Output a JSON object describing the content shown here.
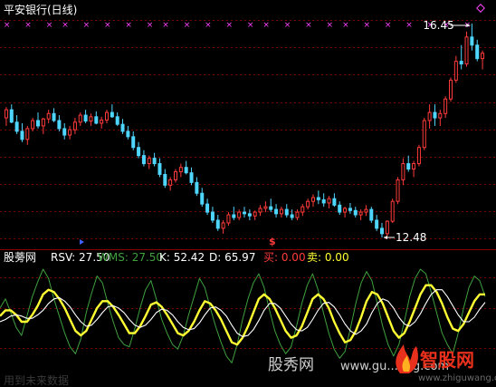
{
  "chart_data": [
    {
      "type": "candlestick",
      "title": "平安银行(日线)",
      "annotations": {
        "high_label": "16.45",
        "low_label": "12.48",
        "signal_glyph": "$"
      },
      "x_markers": {
        "glyph": "×",
        "count": 24
      },
      "colors": {
        "up": "#ff3b3b",
        "down": "#4fd6ff",
        "grid": "#7a0000",
        "title": "#ffffff",
        "marker": "#ff44ff",
        "signal": "#ff3b3b"
      },
      "series": [
        {
          "name": "candles",
          "values": [
            [
              14.7,
              14.9,
              14.55,
              14.85
            ],
            [
              14.85,
              14.95,
              14.6,
              14.62
            ],
            [
              14.62,
              14.75,
              14.4,
              14.45
            ],
            [
              14.45,
              14.6,
              14.25,
              14.3
            ],
            [
              14.3,
              14.55,
              14.2,
              14.5
            ],
            [
              14.5,
              14.7,
              14.45,
              14.65
            ],
            [
              14.65,
              14.8,
              14.5,
              14.55
            ],
            [
              14.55,
              14.7,
              14.4,
              14.68
            ],
            [
              14.68,
              14.85,
              14.6,
              14.78
            ],
            [
              14.78,
              14.88,
              14.62,
              14.65
            ],
            [
              14.65,
              14.75,
              14.45,
              14.5
            ],
            [
              14.5,
              14.6,
              14.3,
              14.38
            ],
            [
              14.38,
              14.55,
              14.3,
              14.48
            ],
            [
              14.48,
              14.7,
              14.4,
              14.62
            ],
            [
              14.62,
              14.8,
              14.55,
              14.75
            ],
            [
              14.75,
              14.85,
              14.6,
              14.64
            ],
            [
              14.64,
              14.78,
              14.55,
              14.72
            ],
            [
              14.72,
              14.82,
              14.58,
              14.6
            ],
            [
              14.6,
              14.72,
              14.5,
              14.66
            ],
            [
              14.66,
              14.85,
              14.6,
              14.8
            ],
            [
              14.8,
              14.95,
              14.7,
              14.72
            ],
            [
              14.72,
              14.8,
              14.55,
              14.58
            ],
            [
              14.58,
              14.68,
              14.4,
              14.45
            ],
            [
              14.45,
              14.55,
              14.3,
              14.35
            ],
            [
              14.35,
              14.45,
              14.1,
              14.15
            ],
            [
              14.15,
              14.25,
              13.95,
              14.0
            ],
            [
              14.0,
              14.1,
              13.8,
              13.85
            ],
            [
              13.85,
              14.0,
              13.75,
              13.95
            ],
            [
              13.95,
              14.05,
              13.8,
              13.85
            ],
            [
              13.85,
              13.95,
              13.6,
              13.65
            ],
            [
              13.65,
              13.75,
              13.4,
              13.45
            ],
            [
              13.45,
              13.6,
              13.35,
              13.55
            ],
            [
              13.55,
              13.75,
              13.5,
              13.7
            ],
            [
              13.7,
              13.85,
              13.6,
              13.78
            ],
            [
              13.78,
              13.9,
              13.65,
              13.68
            ],
            [
              13.68,
              13.78,
              13.45,
              13.5
            ],
            [
              13.5,
              13.6,
              13.25,
              13.3
            ],
            [
              13.3,
              13.4,
              13.05,
              13.1
            ],
            [
              13.1,
              13.2,
              12.9,
              12.95
            ],
            [
              12.95,
              13.05,
              12.75,
              12.8
            ],
            [
              12.8,
              12.9,
              12.6,
              12.65
            ],
            [
              12.65,
              12.8,
              12.55,
              12.75
            ],
            [
              12.75,
              12.95,
              12.7,
              12.9
            ],
            [
              12.9,
              13.05,
              12.8,
              12.85
            ],
            [
              12.85,
              13.0,
              12.8,
              12.95
            ],
            [
              12.95,
              13.05,
              12.85,
              12.92
            ],
            [
              12.92,
              13.0,
              12.8,
              12.88
            ],
            [
              12.88,
              12.98,
              12.8,
              12.95
            ],
            [
              12.95,
              13.08,
              12.88,
              13.02
            ],
            [
              13.02,
              13.15,
              12.95,
              13.05
            ],
            [
              13.05,
              13.2,
              12.95,
              13.0
            ],
            [
              13.0,
              13.1,
              12.85,
              12.92
            ],
            [
              12.92,
              13.05,
              12.85,
              13.0
            ],
            [
              13.0,
              13.1,
              12.85,
              12.9
            ],
            [
              12.9,
              13.0,
              12.8,
              12.85
            ],
            [
              12.85,
              13.0,
              12.8,
              12.95
            ],
            [
              12.95,
              13.1,
              12.88,
              13.05
            ],
            [
              13.05,
              13.2,
              13.0,
              13.15
            ],
            [
              13.15,
              13.28,
              13.05,
              13.22
            ],
            [
              13.22,
              13.35,
              13.1,
              13.18
            ],
            [
              13.18,
              13.3,
              13.05,
              13.12
            ],
            [
              13.12,
              13.25,
              13.02,
              13.2
            ],
            [
              13.2,
              13.3,
              13.05,
              13.08
            ],
            [
              13.08,
              13.15,
              12.9,
              12.95
            ],
            [
              12.95,
              13.05,
              12.85,
              13.02
            ],
            [
              13.02,
              13.12,
              12.92,
              12.98
            ],
            [
              12.98,
              13.05,
              12.85,
              12.9
            ],
            [
              12.9,
              13.0,
              12.8,
              12.95
            ],
            [
              12.95,
              13.08,
              12.88,
              13.0
            ],
            [
              13.0,
              13.05,
              12.75,
              12.8
            ],
            [
              12.8,
              12.9,
              12.6,
              12.65
            ],
            [
              12.65,
              12.75,
              12.48,
              12.55
            ],
            [
              12.55,
              12.8,
              12.5,
              12.78
            ],
            [
              12.78,
              13.2,
              12.75,
              13.15
            ],
            [
              13.15,
              13.6,
              13.1,
              13.55
            ],
            [
              13.55,
              13.95,
              13.45,
              13.85
            ],
            [
              13.85,
              14.0,
              13.7,
              13.75
            ],
            [
              13.75,
              13.9,
              13.6,
              13.85
            ],
            [
              13.85,
              14.2,
              13.8,
              14.15
            ],
            [
              14.15,
              14.7,
              14.1,
              14.65
            ],
            [
              14.65,
              14.95,
              14.5,
              14.8
            ],
            [
              14.8,
              14.95,
              14.55,
              14.7
            ],
            [
              14.7,
              14.85,
              14.55,
              14.78
            ],
            [
              14.78,
              15.1,
              14.7,
              15.05
            ],
            [
              15.05,
              15.45,
              15.0,
              15.4
            ],
            [
              15.4,
              15.85,
              15.35,
              15.75
            ],
            [
              15.75,
              16.05,
              15.6,
              15.7
            ],
            [
              15.7,
              16.3,
              15.65,
              16.2
            ],
            [
              16.2,
              16.45,
              15.95,
              16.05
            ],
            [
              16.05,
              16.15,
              15.75,
              15.8
            ],
            [
              15.8,
              15.95,
              15.6,
              15.9
            ]
          ]
        }
      ]
    },
    {
      "type": "line",
      "indicator_name": "股蒡网",
      "legend": [
        {
          "label": "RSV: 27.50",
          "color": "#ffffff"
        },
        {
          "label": "WMS: 27.50",
          "color": "#3fa03f"
        },
        {
          "label": "K: 52.42",
          "color": "#ffffff"
        },
        {
          "label": "D: 65.97",
          "color": "#ffffff"
        },
        {
          "label": "买: 0.00",
          "color": "#ff3b3b"
        },
        {
          "label": "卖: 0.00",
          "color": "#ffff33"
        }
      ],
      "ylim": [
        0,
        100
      ],
      "series": [
        {
          "name": "RSV",
          "color": "#3fa03f",
          "values": [
            62,
            70,
            58,
            45,
            38,
            55,
            72,
            85,
            96,
            88,
            70,
            55,
            40,
            28,
            22,
            35,
            58,
            75,
            90,
            84,
            66,
            50,
            36,
            30,
            28,
            44,
            62,
            78,
            86,
            70,
            52,
            40,
            30,
            26,
            38,
            56,
            72,
            88,
            80,
            62,
            46,
            32,
            20,
            14,
            30,
            52,
            70,
            84,
            92,
            80,
            60,
            42,
            30,
            22,
            28,
            46,
            66,
            82,
            92,
            78,
            58,
            40,
            26,
            18,
            24,
            44,
            66,
            84,
            94,
            86,
            66,
            46,
            30,
            20,
            30,
            50,
            72,
            88,
            96,
            92,
            76,
            58,
            40,
            30,
            22,
            40,
            62,
            80,
            90,
            86,
            72
          ]
        },
        {
          "name": "K",
          "color": "#ffff33",
          "values": [
            55,
            60,
            60,
            56,
            50,
            50,
            56,
            64,
            74,
            78,
            76,
            70,
            62,
            52,
            42,
            38,
            42,
            52,
            62,
            68,
            68,
            63,
            56,
            48,
            40,
            40,
            46,
            55,
            65,
            67,
            63,
            56,
            48,
            40,
            38,
            42,
            50,
            60,
            68,
            66,
            60,
            52,
            42,
            32,
            30,
            36,
            46,
            58,
            70,
            74,
            70,
            62,
            52,
            42,
            36,
            38,
            46,
            58,
            70,
            74,
            70,
            62,
            50,
            40,
            32,
            34,
            42,
            54,
            68,
            76,
            74,
            66,
            54,
            42,
            36,
            40,
            50,
            62,
            74,
            82,
            82,
            76,
            66,
            54,
            44,
            42,
            48,
            58,
            68,
            74,
            74
          ]
        },
        {
          "name": "D",
          "color": "#ffffff",
          "values": [
            50,
            52,
            55,
            56,
            55,
            53,
            53,
            56,
            60,
            66,
            70,
            71,
            68,
            63,
            56,
            50,
            46,
            47,
            52,
            58,
            63,
            64,
            62,
            58,
            52,
            47,
            45,
            47,
            52,
            58,
            61,
            60,
            56,
            50,
            45,
            43,
            44,
            49,
            56,
            62,
            63,
            60,
            55,
            47,
            40,
            37,
            38,
            43,
            51,
            60,
            66,
            66,
            62,
            55,
            48,
            43,
            42,
            45,
            52,
            60,
            66,
            67,
            63,
            56,
            48,
            42,
            39,
            42,
            48,
            58,
            66,
            70,
            68,
            62,
            54,
            48,
            46,
            50,
            57,
            66,
            74,
            78,
            78,
            72,
            64,
            56,
            50,
            50,
            54,
            61,
            67
          ]
        }
      ]
    }
  ],
  "watermarks": {
    "left_faded": "用到未来数据",
    "center": "股秀网",
    "center_sub": "www.gu...ang.com",
    "logo_cn": "智股网",
    "logo_url": "www.zhiguwang.com"
  }
}
